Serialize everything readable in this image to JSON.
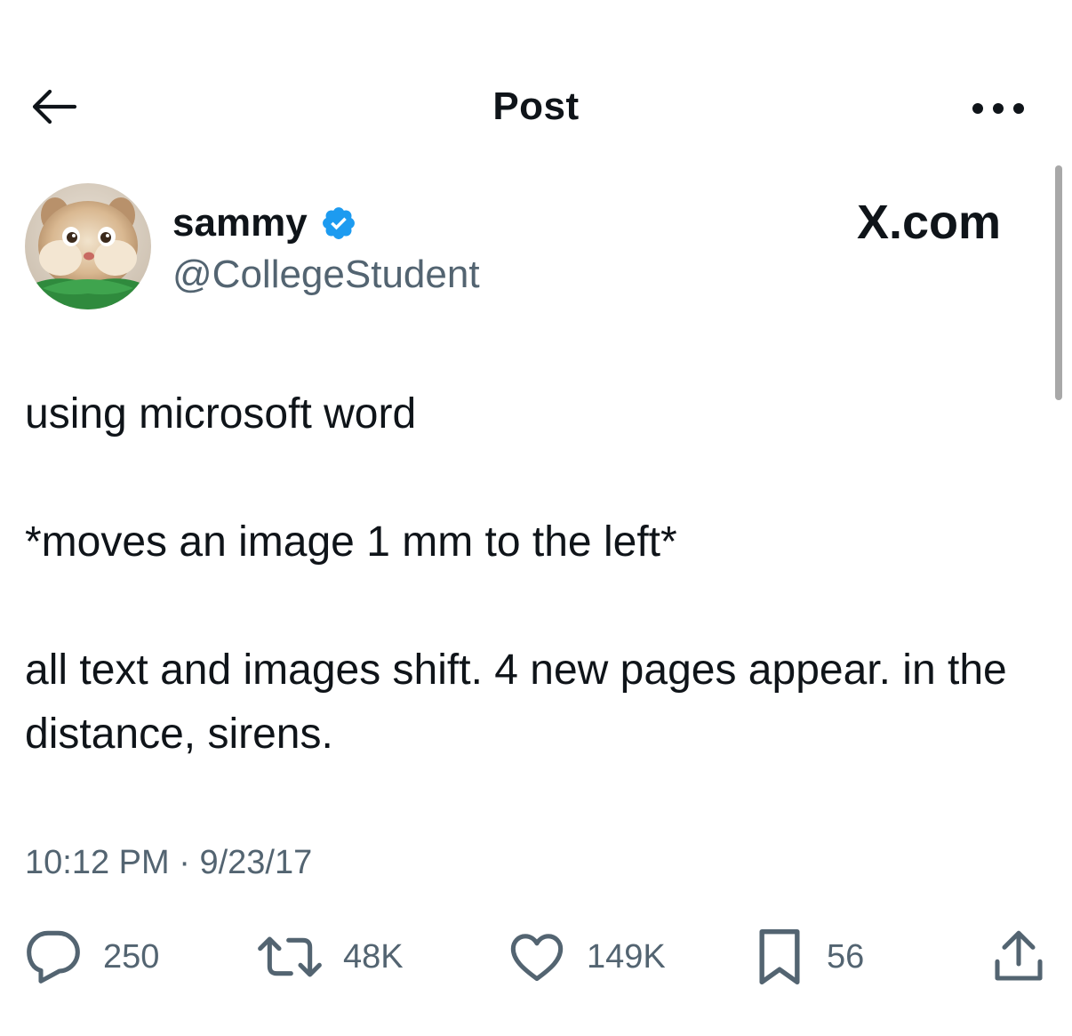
{
  "header": {
    "title": "Post",
    "back_icon": "arrow-left-icon",
    "more_icon": "more-horizontal-icon"
  },
  "author": {
    "display_name": "sammy",
    "verified": true,
    "handle": "@CollegeStudent",
    "avatar_icon": "avatar-chipmunk"
  },
  "watermark": {
    "text": "X.com"
  },
  "tweet": {
    "paragraphs": [
      "using microsoft word",
      "*moves an image 1 mm to the left*",
      "all text and images shift. 4 new pages appear. in the distance, sirens."
    ]
  },
  "meta": {
    "time": "10:12 PM",
    "separator": "·",
    "date": "9/23/17"
  },
  "actions": {
    "replies": "250",
    "reposts": "48K",
    "likes": "149K",
    "bookmarks": "56"
  },
  "colors": {
    "text_primary": "#0f1419",
    "text_secondary": "#536471",
    "verified_blue": "#1d9bf0"
  }
}
